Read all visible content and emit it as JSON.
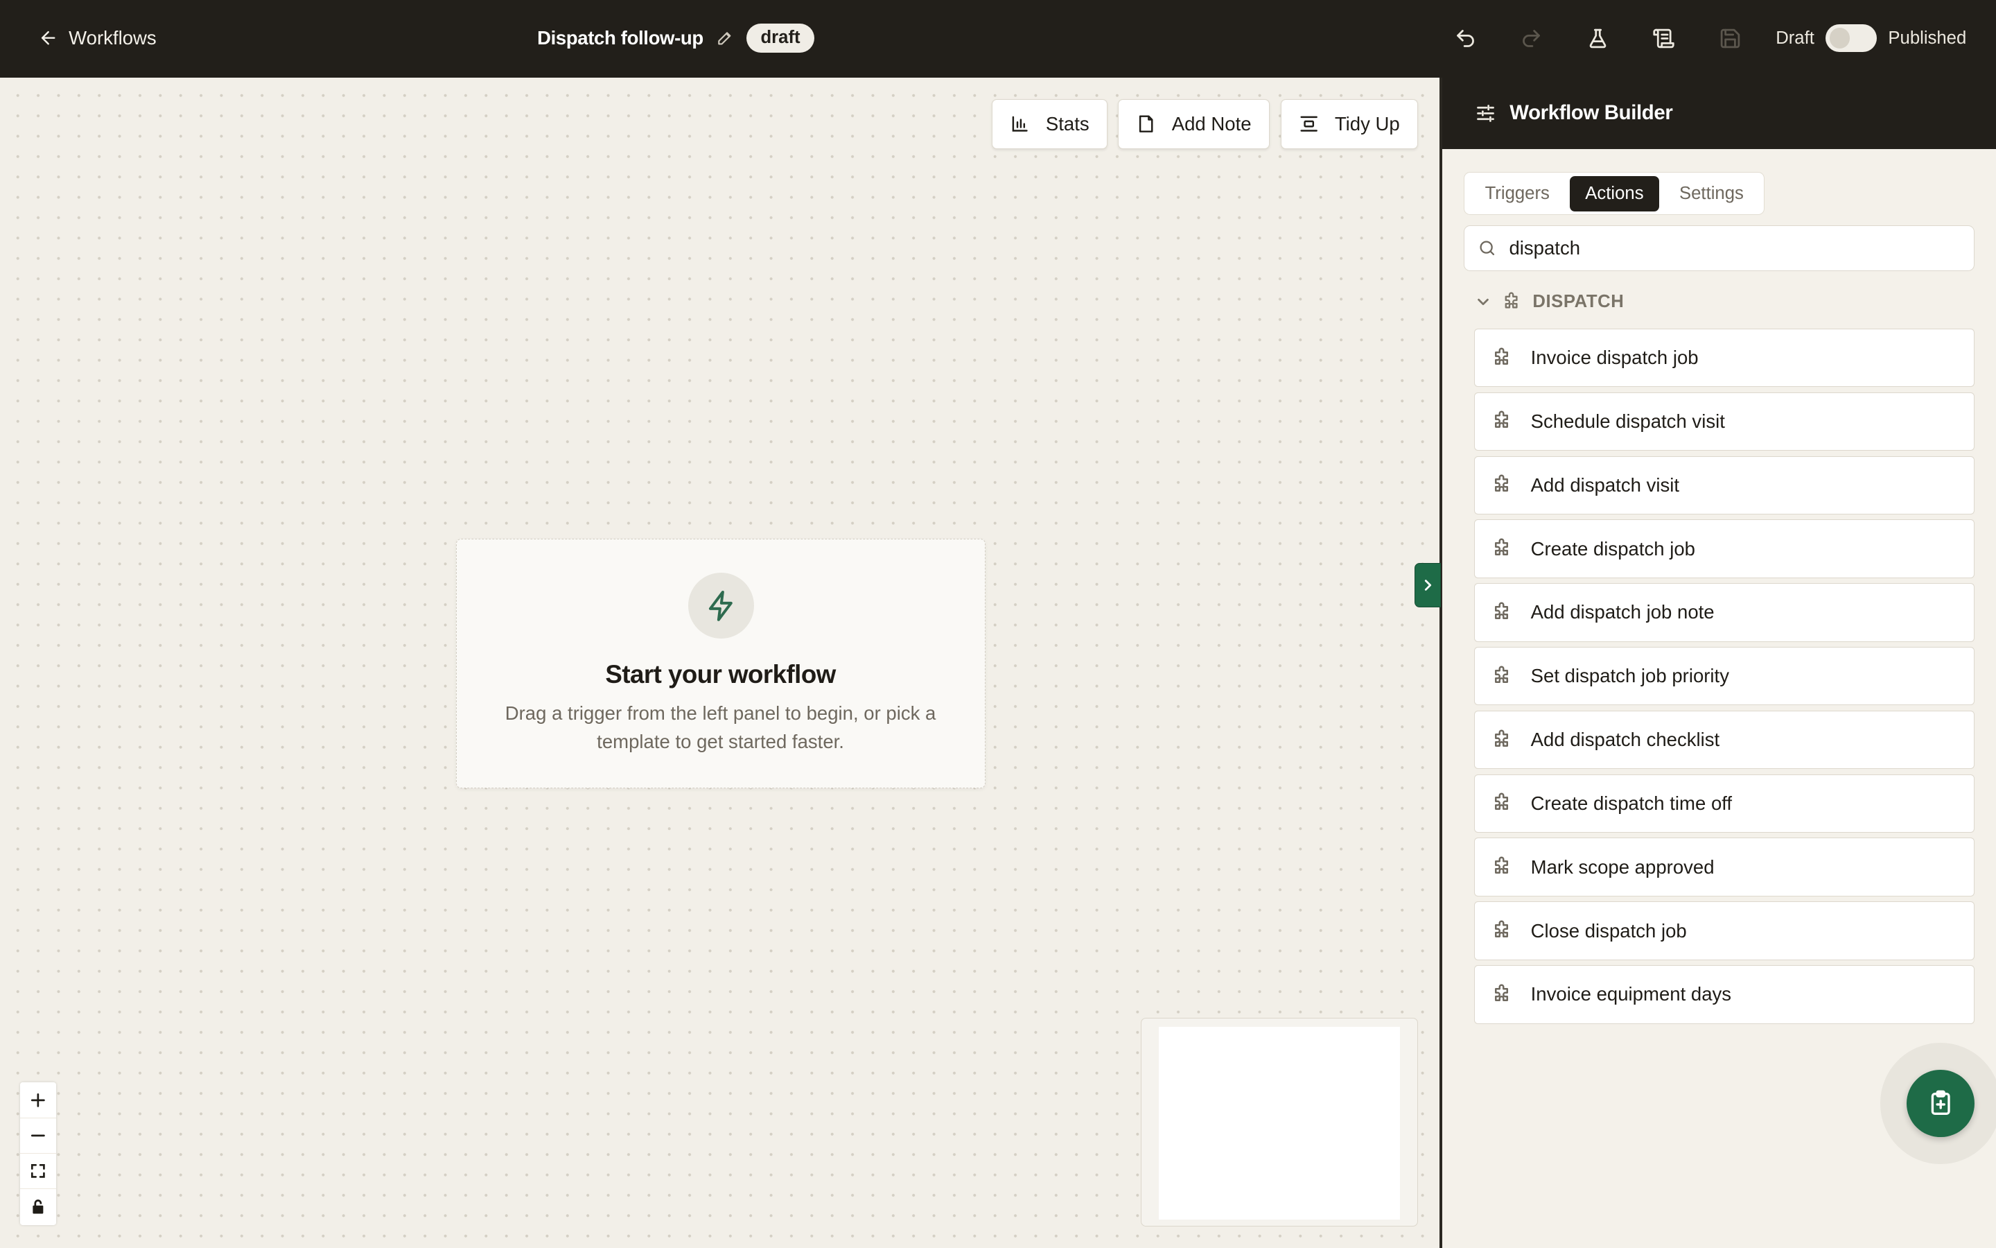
{
  "topbar": {
    "back_label": "Workflows",
    "workflow_title": "Dispatch follow-up",
    "status_badge": "draft",
    "icons": [
      "undo-icon",
      "redo-icon",
      "flask-icon",
      "history-icon",
      "save-icon"
    ],
    "toggle": {
      "left_label": "Draft",
      "right_label": "Published",
      "state": "draft"
    }
  },
  "canvas": {
    "buttons": {
      "stats": "Stats",
      "add_note": "Add Note",
      "tidy_up": "Tidy Up"
    },
    "empty_state": {
      "title": "Start your workflow",
      "description": "Drag a trigger from the left panel to begin, or pick a template to get started faster."
    }
  },
  "panel": {
    "title": "Workflow Builder",
    "tabs": [
      {
        "label": "Triggers",
        "active": false
      },
      {
        "label": "Actions",
        "active": true
      },
      {
        "label": "Settings",
        "active": false
      }
    ],
    "search": {
      "value": "dispatch",
      "placeholder": ""
    },
    "group": {
      "label": "DISPATCH",
      "expanded": true,
      "items": [
        "Invoice dispatch job",
        "Schedule dispatch visit",
        "Add dispatch visit",
        "Create dispatch job",
        "Add dispatch job note",
        "Set dispatch job priority",
        "Add dispatch checklist",
        "Create dispatch time off",
        "Mark scope approved",
        "Close dispatch job",
        "Invoice equipment days"
      ]
    }
  },
  "colors": {
    "topbar": "#221f1a",
    "canvas": "#f2efe8",
    "accent": "#1e6b47",
    "panel": "#f4f1ea"
  }
}
